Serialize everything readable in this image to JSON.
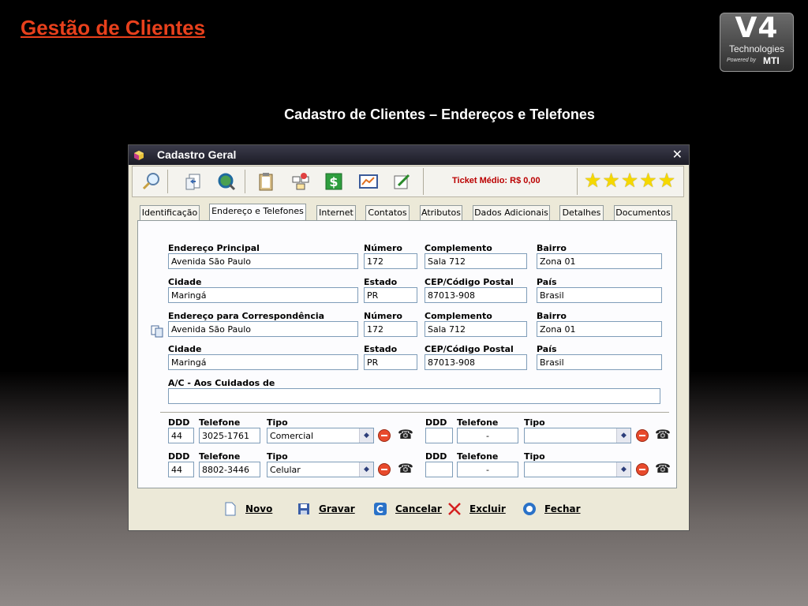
{
  "slide": {
    "title": "Gestão de Clientes",
    "subtitle": "Cadastro de Clientes – Endereços e Telefones",
    "logo": {
      "brand": "V4",
      "line1": "Technologies",
      "powered_by": "Powered by",
      "company": "MTI"
    }
  },
  "window": {
    "title": "Cadastro Geral",
    "close": "✕"
  },
  "toolbar": {
    "buttons": [
      "search-icon",
      "new-document-icon",
      "globe-search-icon",
      "clipboard-icon",
      "network-icon",
      "money-icon",
      "chart-icon",
      "edit-note-icon"
    ],
    "ticket_label": "Ticket Médio: R$ 0,00",
    "rating": 5
  },
  "tabs": [
    "Identificação",
    "Endereço e Telefones",
    "Internet",
    "Contatos",
    "Atributos",
    "Dados Adicionais",
    "Detalhes",
    "Documentos"
  ],
  "active_tab": "Endereço e Telefones",
  "address_principal": {
    "label_endereco": "Endereço Principal",
    "endereco": "Avenida São Paulo",
    "label_numero": "Número",
    "numero": "172",
    "label_complemento": "Complemento",
    "complemento": "Sala 712",
    "label_bairro": "Bairro",
    "bairro": "Zona 01",
    "label_cidade": "Cidade",
    "cidade": "Maringá",
    "label_estado": "Estado",
    "estado": "PR",
    "label_cep": "CEP/Código Postal",
    "cep": "87013-908",
    "label_pais": "País",
    "pais": "Brasil"
  },
  "address_correspondencia": {
    "label_endereco": "Endereço para Correspondência",
    "endereco": "Avenida São Paulo",
    "label_numero": "Número",
    "numero": "172",
    "label_complemento": "Complemento",
    "complemento": "Sala 712",
    "label_bairro": "Bairro",
    "bairro": "Zona 01",
    "label_cidade": "Cidade",
    "cidade": "Maringá",
    "label_estado": "Estado",
    "estado": "PR",
    "label_cep": "CEP/Código Postal",
    "cep": "87013-908",
    "label_pais": "País",
    "pais": "Brasil",
    "label_ac": "A/C - Aos Cuidados de",
    "ac": ""
  },
  "phone_labels": {
    "ddd": "DDD",
    "telefone": "Telefone",
    "tipo": "Tipo"
  },
  "phones": [
    {
      "ddd": "44",
      "telefone": "3025-1761",
      "tipo": "Comercial"
    },
    {
      "ddd": "",
      "telefone": "-",
      "tipo": ""
    },
    {
      "ddd": "44",
      "telefone": "8802-3446",
      "tipo": "Celular"
    },
    {
      "ddd": "",
      "telefone": "-",
      "tipo": ""
    }
  ],
  "footer_buttons": {
    "novo": "Novo",
    "gravar": "Gravar",
    "cancelar": "Cancelar",
    "excluir": "Excluir",
    "fechar": "Fechar"
  },
  "colors": {
    "title_red": "#e8401c",
    "ticket_red": "#bb0000",
    "star_yellow": "#f5d800"
  }
}
